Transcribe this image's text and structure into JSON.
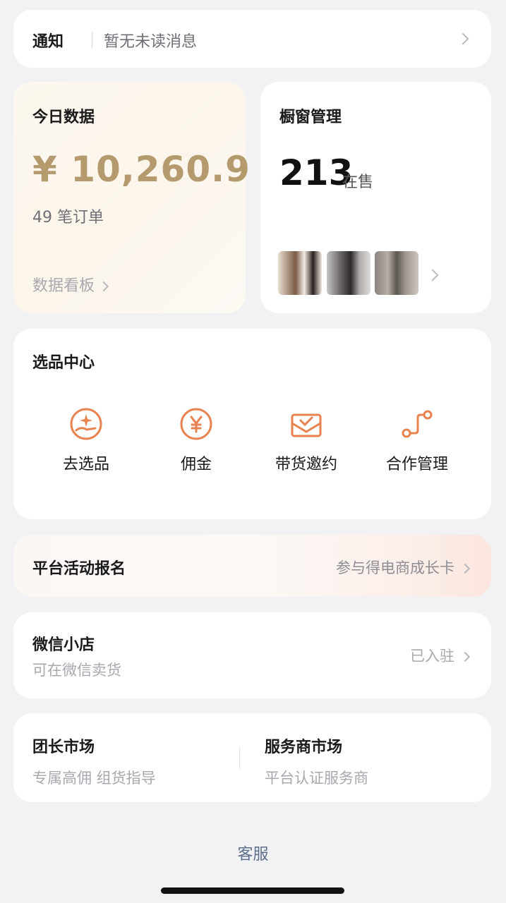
{
  "notice": {
    "title": "通知",
    "message": "暂无未读消息"
  },
  "today_data": {
    "title": "今日数据",
    "amount": "¥ 10,260.9",
    "orders": "49 笔订单",
    "dashboard_link": "数据看板"
  },
  "showcase": {
    "title": "橱窗管理",
    "count": "213",
    "count_label": "在售"
  },
  "selection_center": {
    "title": "选品中心",
    "tools": [
      {
        "label": "去选品",
        "icon": "hand-star-icon"
      },
      {
        "label": "佣金",
        "icon": "yen-coin-icon"
      },
      {
        "label": "带货邀约",
        "icon": "envelope-check-icon"
      },
      {
        "label": "合作管理",
        "icon": "connection-icon"
      }
    ],
    "accent_color": "#e8824f"
  },
  "platform_activity": {
    "title": "平台活动报名",
    "action": "参与得电商成长卡"
  },
  "wechat_store": {
    "title": "微信小店",
    "subtitle": "可在微信卖货",
    "status": "已入驻"
  },
  "markets": [
    {
      "title": "团长市场",
      "subtitle": "专属高佣 组货指导"
    },
    {
      "title": "服务商市场",
      "subtitle": "平台认证服务商"
    }
  ],
  "footer": {
    "service": "客服"
  }
}
